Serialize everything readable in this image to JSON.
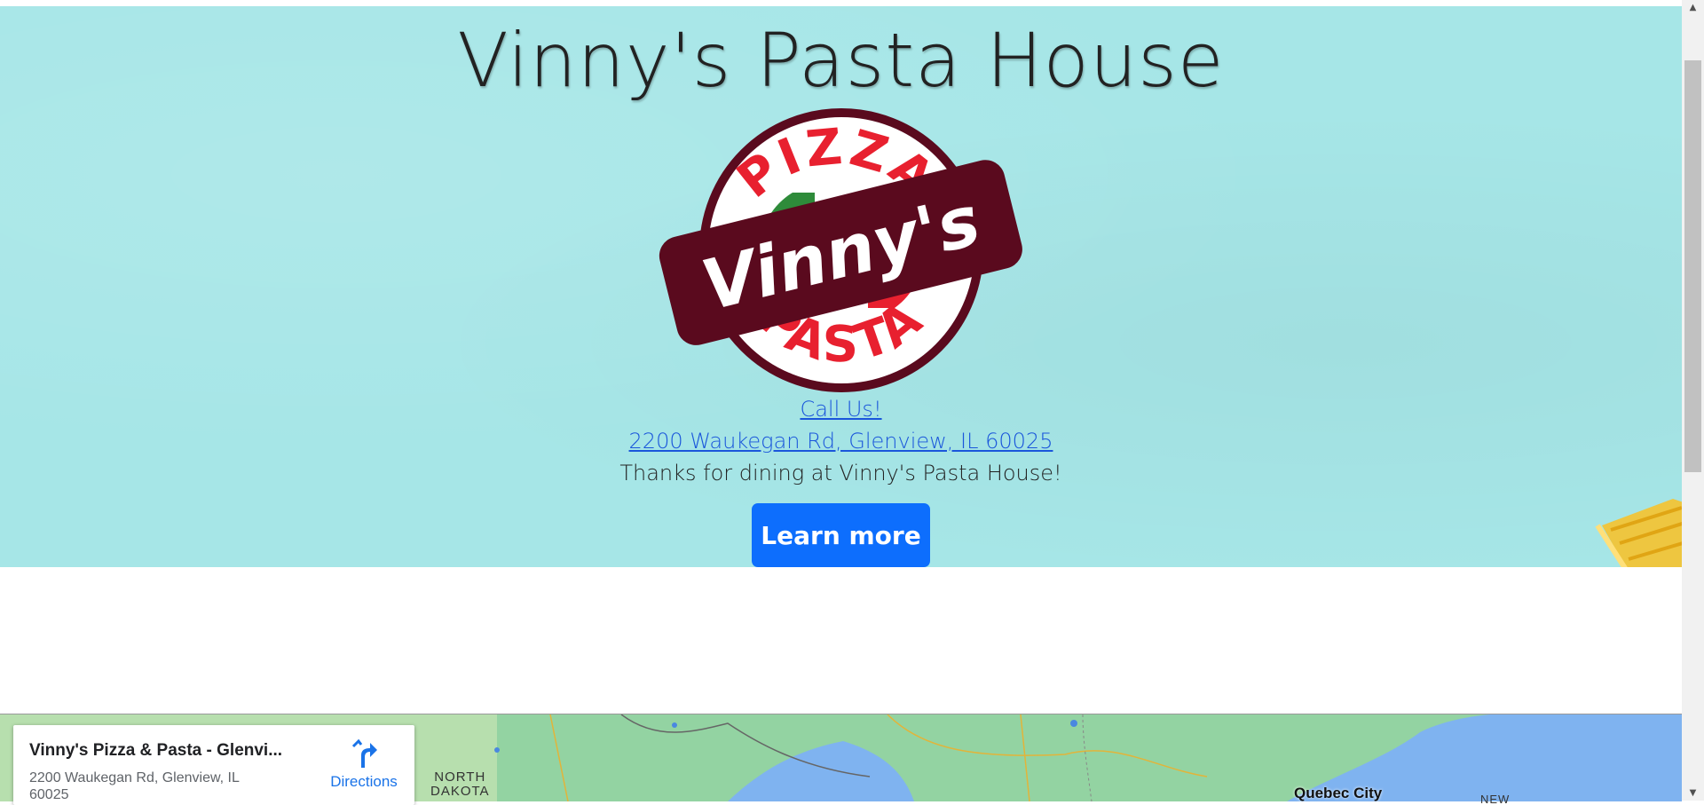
{
  "hero": {
    "title": "Vinny's Pasta House",
    "logo": {
      "top_text": "PIZZA",
      "name": "Vinny's",
      "bottom_text": "PASTA"
    },
    "call_link": "Call Us!",
    "address_link": "2200 Waukegan Rd, Glenview, IL 60025",
    "thanks": "Thanks for dining at Vinny's Pasta House!",
    "learn_more": "Learn more"
  },
  "map": {
    "place_name": "Vinny's Pizza & Pasta - Glenvi...",
    "place_address": "2200 Waukegan Rd, Glenview, IL 60025",
    "directions_label": "Directions",
    "region_label_1": "NORTH",
    "region_label_2": "DAKOTA",
    "city_label": "Quebec City",
    "region_label_3": "NEW"
  },
  "scrollbar": {
    "up_icon": "▲",
    "down_icon": "▼"
  },
  "colors": {
    "hero_bg": "#a6e6e7",
    "button": "#0d6efd",
    "link": "#1a56db",
    "logo_band": "#5a0a1e",
    "logo_red": "#e8202f",
    "logo_green": "#2e8b3a"
  }
}
